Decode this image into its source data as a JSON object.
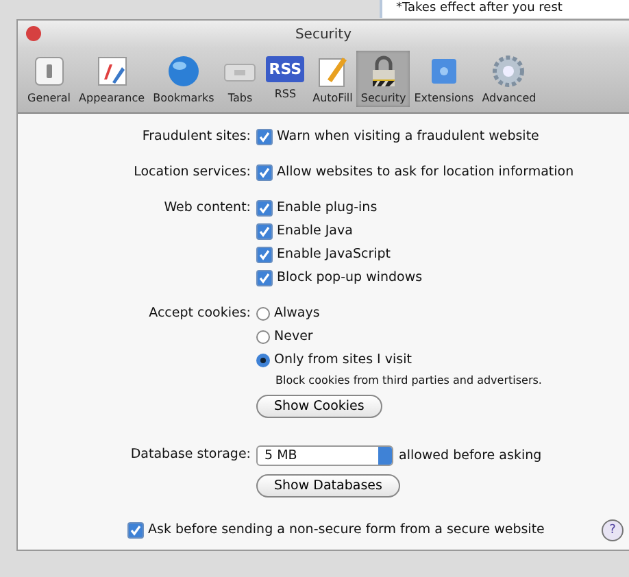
{
  "background_window": {
    "note": "*Takes effect after you rest"
  },
  "window": {
    "title": "Security"
  },
  "toolbar": [
    {
      "label": "General",
      "kind": "general",
      "selected": false
    },
    {
      "label": "Appearance",
      "kind": "appearance",
      "selected": false
    },
    {
      "label": "Bookmarks",
      "kind": "bookmarks",
      "selected": false
    },
    {
      "label": "Tabs",
      "kind": "tabs",
      "selected": false
    },
    {
      "label": "RSS",
      "kind": "rss",
      "badge": "RSS",
      "selected": false
    },
    {
      "label": "AutoFill",
      "kind": "autofill",
      "selected": false
    },
    {
      "label": "Security",
      "kind": "security",
      "selected": true
    },
    {
      "label": "Extensions",
      "kind": "extensions",
      "selected": false
    },
    {
      "label": "Advanced",
      "kind": "advanced",
      "selected": false
    }
  ],
  "fraudulent_sites": {
    "label": "Fraudulent sites:",
    "option": {
      "text": "Warn when visiting a fraudulent website",
      "checked": true
    }
  },
  "location_services": {
    "label": "Location services:",
    "option": {
      "text": "Allow websites to ask for location information",
      "checked": true
    }
  },
  "web_content": {
    "label": "Web content:",
    "options": [
      {
        "text": "Enable plug-ins",
        "checked": true
      },
      {
        "text": "Enable Java",
        "checked": true
      },
      {
        "text": "Enable JavaScript",
        "checked": true
      },
      {
        "text": "Block pop-up windows",
        "checked": true
      }
    ]
  },
  "accept_cookies": {
    "label": "Accept cookies:",
    "options": [
      {
        "text": "Always",
        "selected": false
      },
      {
        "text": "Never",
        "selected": false
      },
      {
        "text": "Only from sites I visit",
        "selected": true
      }
    ],
    "hint": "Block cookies from third parties and advertisers.",
    "button": "Show Cookies"
  },
  "database_storage": {
    "label": "Database storage:",
    "value": "5 MB",
    "suffix": "allowed before asking",
    "button": "Show Databases"
  },
  "non_secure_form": {
    "text": "Ask before sending a non-secure form from a secure website",
    "checked": true
  },
  "help_button": "?"
}
